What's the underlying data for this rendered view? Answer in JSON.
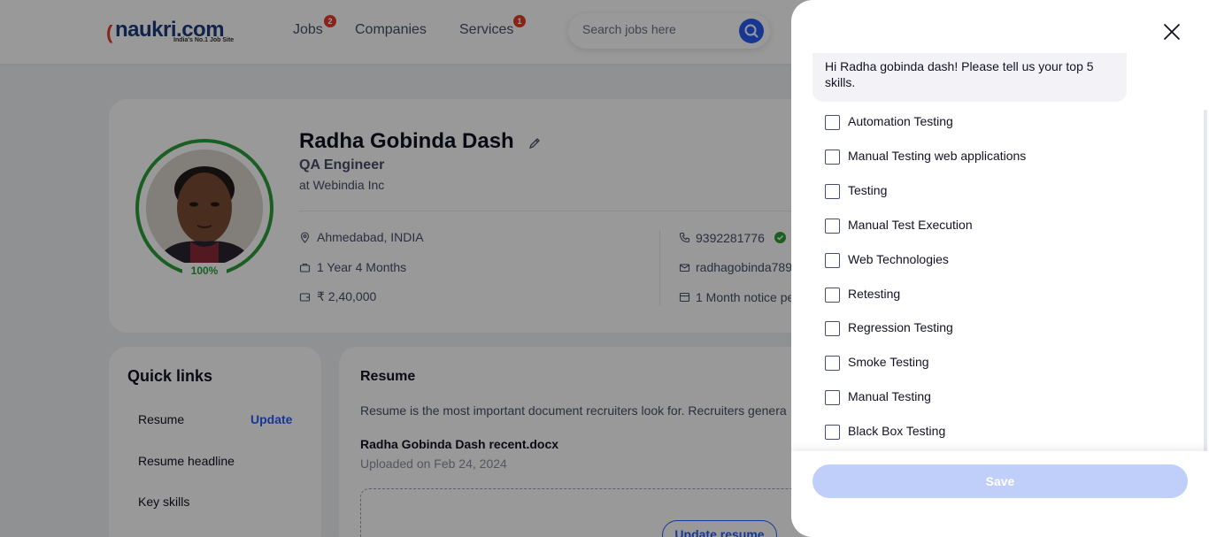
{
  "header": {
    "logo": {
      "brand": "naukri",
      "ext": ".com",
      "tagline": "India's No.1 Job Site"
    },
    "nav": [
      {
        "label": "Jobs",
        "badge": "2"
      },
      {
        "label": "Companies",
        "badge": ""
      },
      {
        "label": "Services",
        "badge": "1"
      }
    ],
    "search": {
      "placeholder": "Search jobs here",
      "icon": "search-icon"
    }
  },
  "profile": {
    "name": "Radha Gobinda Dash",
    "role": "QA Engineer",
    "company": "at Webindia Inc",
    "completion": "100%",
    "location": "Ahmedabad, INDIA",
    "experience": "1 Year 4 Months",
    "salary": "₹ 2,40,000",
    "phone": "9392281776",
    "email": "radhagobinda789",
    "notice": "1 Month notice pe"
  },
  "quick_links": {
    "title": "Quick links",
    "items": [
      "Resume",
      "Resume headline",
      "Key skills"
    ],
    "update_label": "Update"
  },
  "resume": {
    "title": "Resume",
    "description": "Resume is the most important document recruiters look for. Recruiters genera",
    "file_name": "Radha Gobinda Dash recent.docx",
    "uploaded": "Uploaded on Feb 24, 2024",
    "update_button": "Update resume"
  },
  "drawer": {
    "prompt": "Hi Radha gobinda dash! Please tell us your top 5 skills.",
    "skills": [
      {
        "label": "Automation Testing",
        "checked": false
      },
      {
        "label": "Manual Testing web applications",
        "checked": false
      },
      {
        "label": "Testing",
        "checked": false
      },
      {
        "label": "Manual Test Execution",
        "checked": false
      },
      {
        "label": "Web Technologies",
        "checked": false
      },
      {
        "label": "Retesting",
        "checked": false
      },
      {
        "label": "Regression Testing",
        "checked": false
      },
      {
        "label": "Smoke Testing",
        "checked": false
      },
      {
        "label": "Manual Testing",
        "checked": false
      },
      {
        "label": "Black Box Testing",
        "checked": false
      }
    ],
    "save_label": "Save",
    "save_enabled": false
  },
  "colors": {
    "primary": "#275df5",
    "success": "#2d9d3a",
    "badge": "#e23b2a",
    "disabled_button": "#c0cff9",
    "overlay": "rgba(0,0,0,0.4)"
  }
}
